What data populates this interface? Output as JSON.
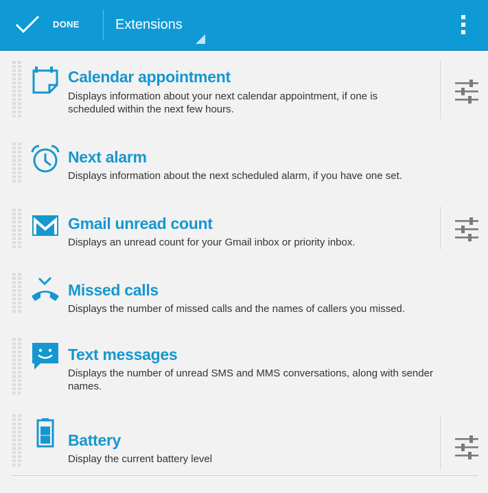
{
  "actionbar": {
    "done_label": "DONE",
    "title": "Extensions",
    "background": "#0f9ad5"
  },
  "extensions": [
    {
      "icon": "calendar-icon",
      "title": "Calendar appointment",
      "description": "Displays information about your next calendar appointment, if one is scheduled within the next few hours.",
      "has_settings": true
    },
    {
      "icon": "alarm-clock-icon",
      "title": "Next alarm",
      "description": "Displays information about the next scheduled alarm, if you have one set.",
      "has_settings": false
    },
    {
      "icon": "gmail-icon",
      "title": "Gmail unread count",
      "description": "Displays an unread count for your Gmail inbox or priority inbox.",
      "has_settings": true
    },
    {
      "icon": "missed-call-icon",
      "title": "Missed calls",
      "description": "Displays the number of missed calls and the names of callers you missed.",
      "has_settings": false
    },
    {
      "icon": "message-icon",
      "title": "Text messages",
      "description": "Displays the number of unread SMS and MMS conversations, along with sender names.",
      "has_settings": false
    },
    {
      "icon": "battery-icon",
      "title": "Battery",
      "description": "Display the current battery level",
      "has_settings": true
    }
  ],
  "colors": {
    "accent": "#1597cf",
    "text": "#333333",
    "background": "#f2f2f2"
  }
}
